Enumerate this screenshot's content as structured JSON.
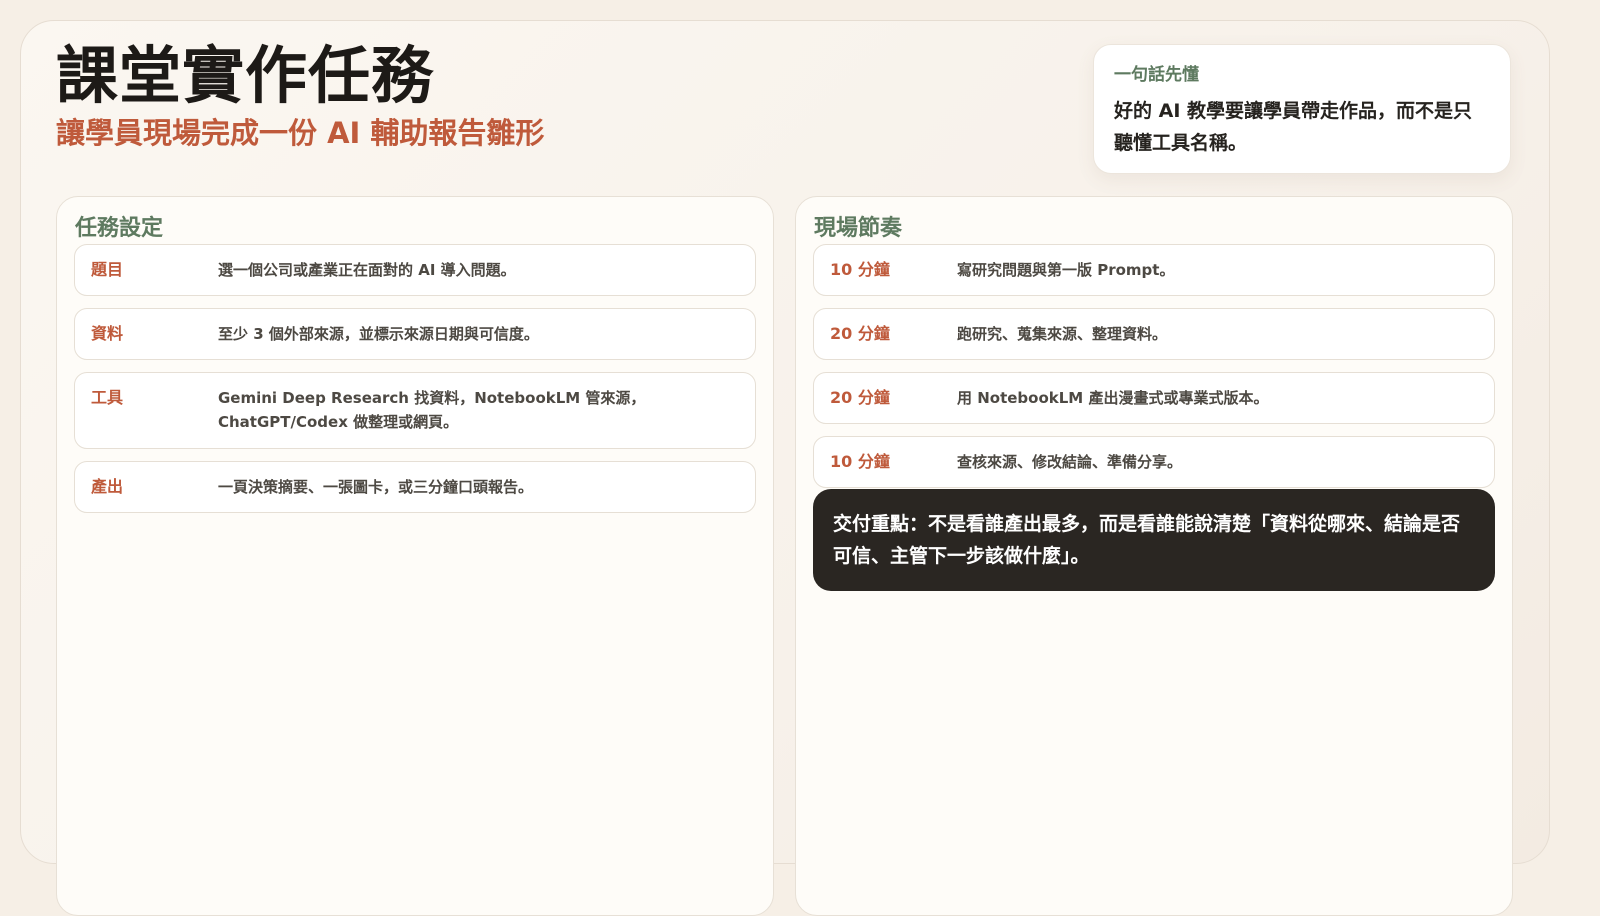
{
  "header": {
    "title": "課堂實作任務",
    "subtitle": "讓學員現場完成一份 AI 輔助報告雛形"
  },
  "callout": {
    "label": "一句話先懂",
    "text": "好的 AI 教學要讓學員帶走作品，而不是只聽懂工具名稱。"
  },
  "task_settings": {
    "title": "任務設定",
    "rows": [
      {
        "key": "題目",
        "value": "選一個公司或產業正在面對的 AI 導入問題。"
      },
      {
        "key": "資料",
        "value": "至少 3 個外部來源，並標示來源日期與可信度。"
      },
      {
        "key": "工具",
        "value": "Gemini Deep Research 找資料，NotebookLM 管來源，ChatGPT/Codex 做整理或網頁。"
      },
      {
        "key": "產出",
        "value": "一頁決策摘要、一張圖卡，或三分鐘口頭報告。"
      }
    ]
  },
  "pacing": {
    "title": "現場節奏",
    "rows": [
      {
        "key": "10 分鐘",
        "value": "寫研究問題與第一版 Prompt。"
      },
      {
        "key": "20 分鐘",
        "value": "跑研究、蒐集來源、整理資料。"
      },
      {
        "key": "20 分鐘",
        "value": "用 NotebookLM 產出漫畫式或專業式版本。"
      },
      {
        "key": "10 分鐘",
        "value": "查核來源、修改結論、準備分享。"
      }
    ],
    "highlight": "交付重點：不是看誰產出最多，而是看誰能說清楚「資料從哪來、結論是否可信、主管下一步該做什麼」。"
  }
}
